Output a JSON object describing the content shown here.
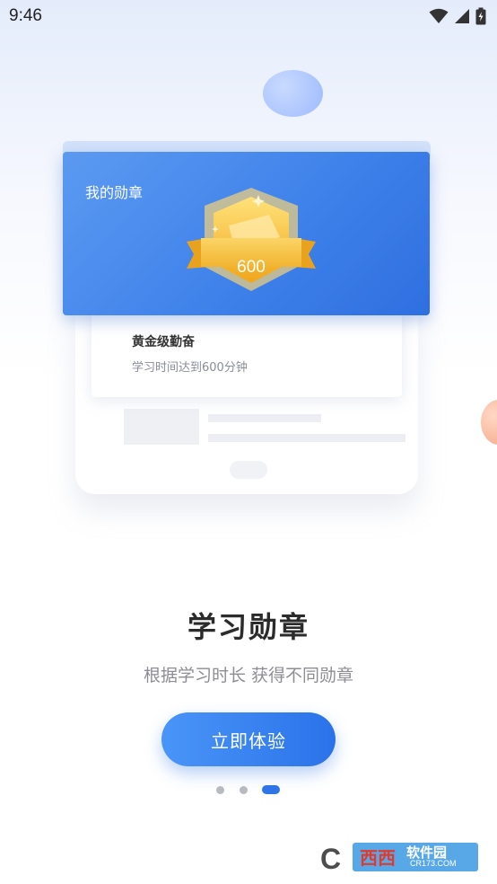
{
  "status_bar": {
    "time": "9:46",
    "icons": [
      "wifi-icon",
      "signal-icon",
      "battery-charging-icon"
    ]
  },
  "illustration": {
    "card_title": "我的勋章",
    "medal_value": "600",
    "badge_name": "黄金级勤奋",
    "badge_desc": "学习时间达到600分钟"
  },
  "onboarding": {
    "title": "学习勋章",
    "subtitle": "根据学习时长 获得不同勋章",
    "cta_label": "立即体验",
    "pager": {
      "total": 3,
      "active_index": 2
    }
  },
  "watermark": {
    "brand": "西西",
    "name": "软件园",
    "url": "CR173.COM"
  },
  "colors": {
    "accent": "#2f74e8",
    "card_blue": "#3f82ea",
    "medal_gold": "#f4b82a"
  }
}
